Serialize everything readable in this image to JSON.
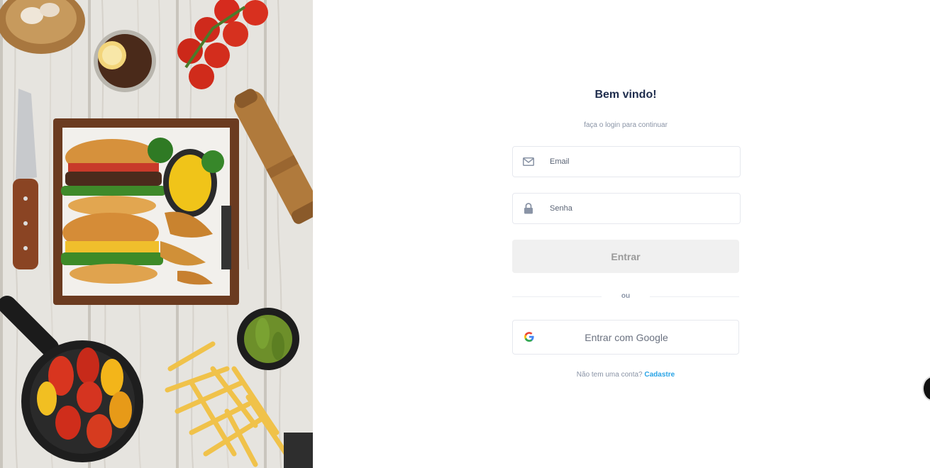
{
  "login": {
    "title": "Bem vindo!",
    "subtitle": "faça o login para continuar",
    "email_placeholder": "Email",
    "password_placeholder": "Senha",
    "submit_label": "Entrar",
    "divider_text": "ou",
    "google_label": "Entrar com Google",
    "signup_prompt": "Não tem uma conta?",
    "signup_link": "Cadastre"
  },
  "icons": {
    "email": "envelope-icon",
    "password": "lock-icon",
    "google": "google-logo-icon"
  },
  "colors": {
    "title": "#1f2d4d",
    "muted_text": "#8a94a6",
    "link": "#2aa4e6",
    "submit_bg": "#f0f0f0",
    "field_border": "#e6e8ee"
  }
}
